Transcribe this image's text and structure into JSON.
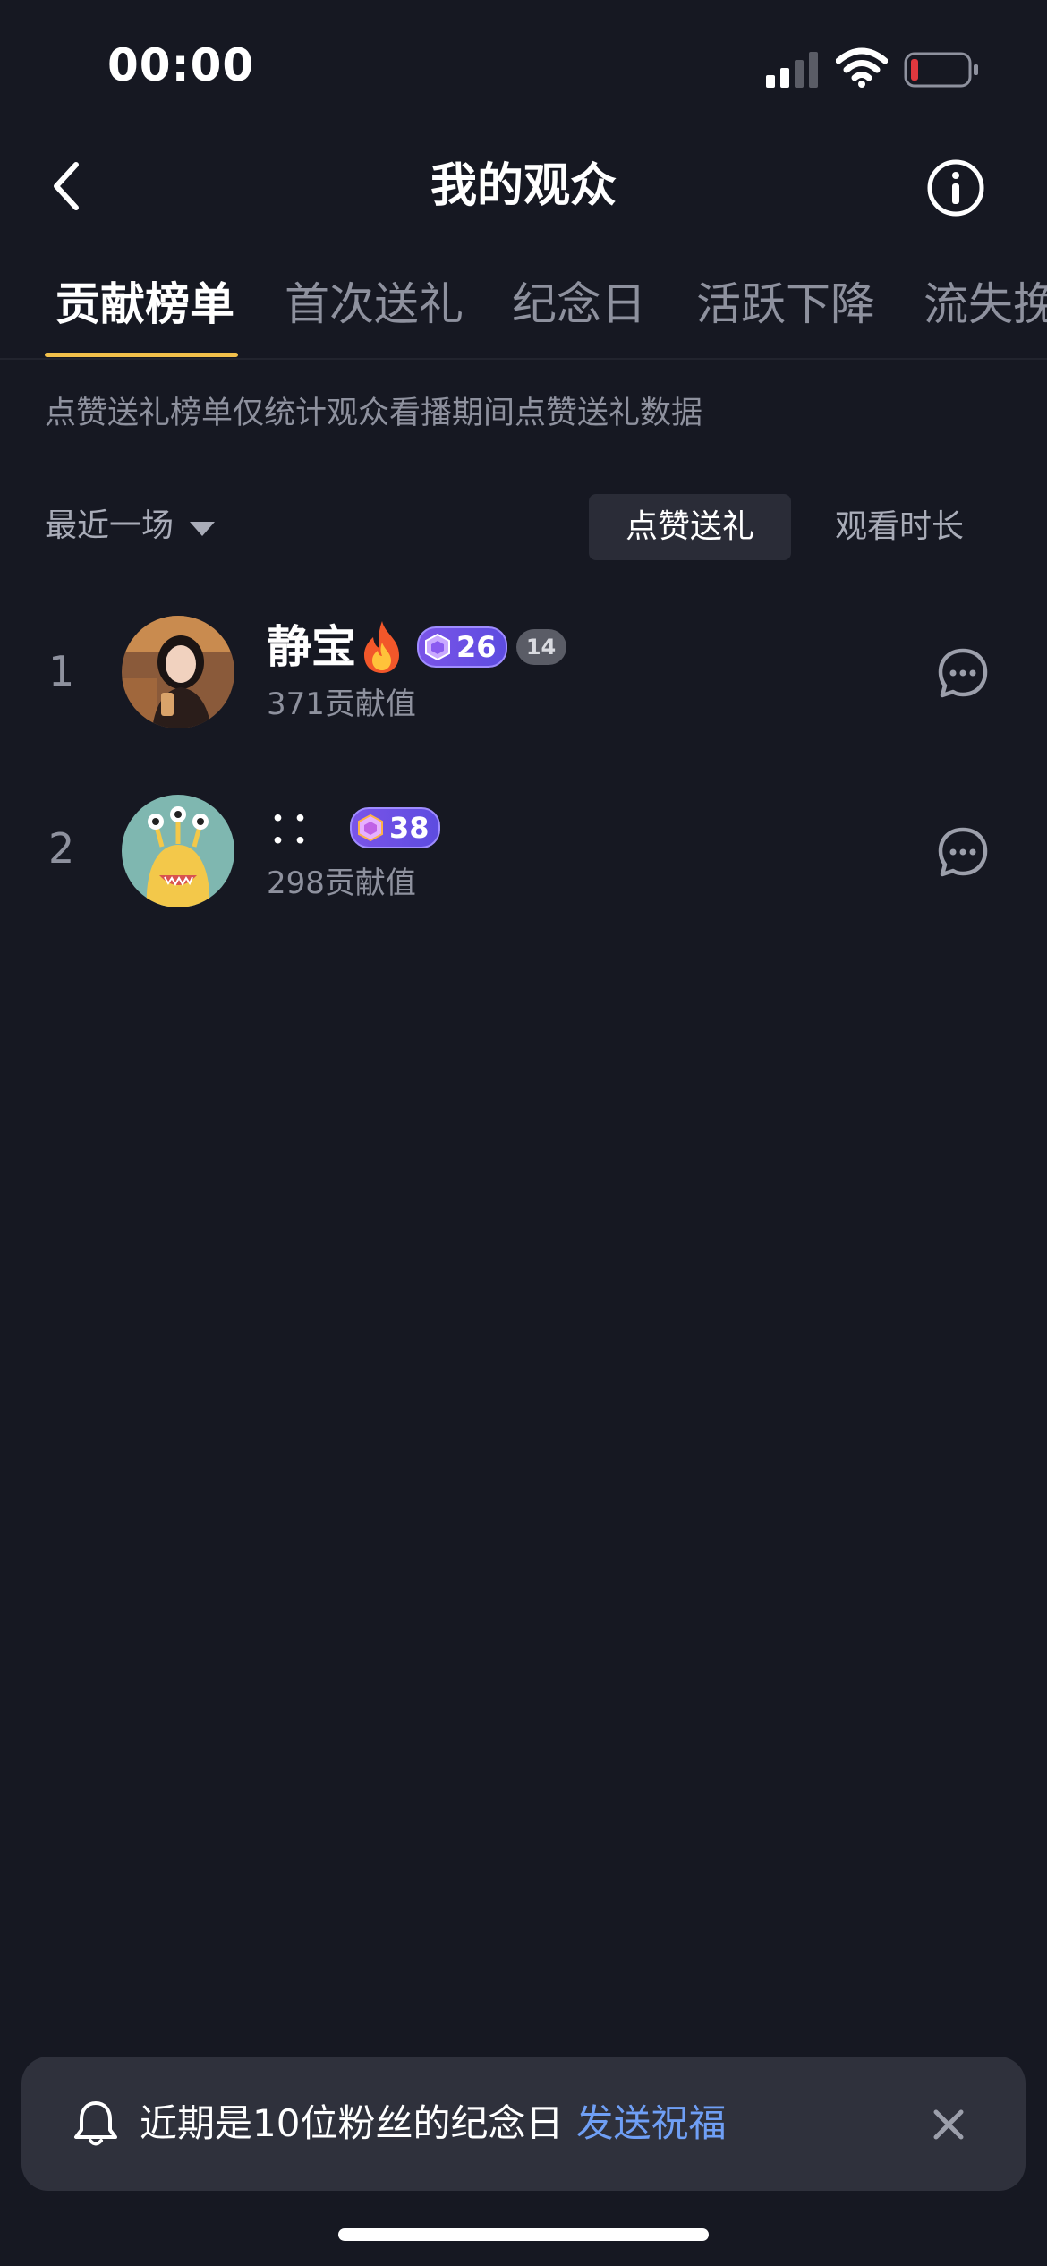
{
  "status_bar": {
    "time": "00:00"
  },
  "nav": {
    "title": "我的观众"
  },
  "tabs": [
    {
      "label": "贡献榜单"
    },
    {
      "label": "首次送礼"
    },
    {
      "label": "纪念日"
    },
    {
      "label": "活跃下降"
    },
    {
      "label": "流失挽"
    }
  ],
  "notice": "点赞送礼榜单仅统计观众看播期间点赞送礼数据",
  "filter": {
    "period": "最近一场",
    "segments": [
      {
        "label": "点赞送礼"
      },
      {
        "label": "观看时长"
      }
    ]
  },
  "audience": [
    {
      "rank": "1",
      "name": "静宝",
      "level": "26",
      "fan_level": "14",
      "score": "371贡献值"
    },
    {
      "rank": "2",
      "name": "：：",
      "level": "38",
      "score": "298贡献值"
    }
  ],
  "toast": {
    "message": "近期是10位粉丝的纪念日",
    "action": "发送祝福"
  },
  "colors": {
    "background": "#161822",
    "accent": "#f2c04b",
    "link": "#6f9ff5",
    "badge": "#7a54e8"
  }
}
